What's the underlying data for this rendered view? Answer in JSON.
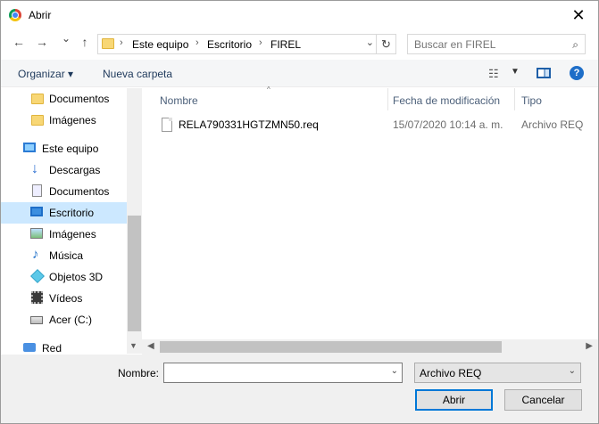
{
  "window": {
    "title": "Abrir",
    "close_glyph": "✕"
  },
  "nav_buttons": {
    "back": "←",
    "forward": "→",
    "recent": "⌄",
    "up": "↑"
  },
  "address": {
    "crumbs": [
      "Este equipo",
      "Escritorio",
      "FIREL"
    ],
    "separator": "›",
    "dropdown_glyph": "⌄",
    "refresh_glyph": "↻"
  },
  "search": {
    "placeholder": "Buscar en FIREL",
    "icon_glyph": "⌕"
  },
  "toolbar": {
    "organize": "Organizar ▾",
    "new_folder": "Nueva carpeta",
    "view_glyph": "☷",
    "view_drop": "▼",
    "help_glyph": "?"
  },
  "navpane": {
    "items": [
      {
        "label": "Documentos",
        "icon": "folder-icon"
      },
      {
        "label": "Imágenes",
        "icon": "folder-icon"
      },
      {
        "label": "Este equipo",
        "icon": "computer-icon"
      },
      {
        "label": "Descargas",
        "icon": "download-icon"
      },
      {
        "label": "Documentos",
        "icon": "document-icon"
      },
      {
        "label": "Escritorio",
        "icon": "desktop-icon",
        "selected": true
      },
      {
        "label": "Imágenes",
        "icon": "pictures-icon"
      },
      {
        "label": "Música",
        "icon": "music-icon"
      },
      {
        "label": "Objetos 3D",
        "icon": "objects-3d-icon"
      },
      {
        "label": "Vídeos",
        "icon": "videos-icon"
      },
      {
        "label": "Acer (C:)",
        "icon": "drive-icon"
      },
      {
        "label": "Red",
        "icon": "network-icon"
      }
    ],
    "down_arrow": "▼",
    "music_glyph": "♪",
    "download_glyph": "↓"
  },
  "filelist": {
    "columns": {
      "name": "Nombre",
      "date": "Fecha de modificación",
      "type": "Tipo",
      "sort_glyph": "^"
    },
    "files": [
      {
        "name": "RELA790331HGTZMN50.req",
        "date": "15/07/2020 10:14 a. m.",
        "type": "Archivo REQ"
      }
    ]
  },
  "hscroll": {
    "left": "◀",
    "right": "▶"
  },
  "bottom": {
    "name_label": "Nombre:",
    "name_value": "",
    "name_drop": "⌄",
    "type_value": "Archivo REQ",
    "type_drop": "⌄",
    "open_label": "Abrir",
    "cancel_label": "Cancelar"
  },
  "colors": {
    "accent": "#0078d7",
    "selected": "#cce8ff"
  }
}
